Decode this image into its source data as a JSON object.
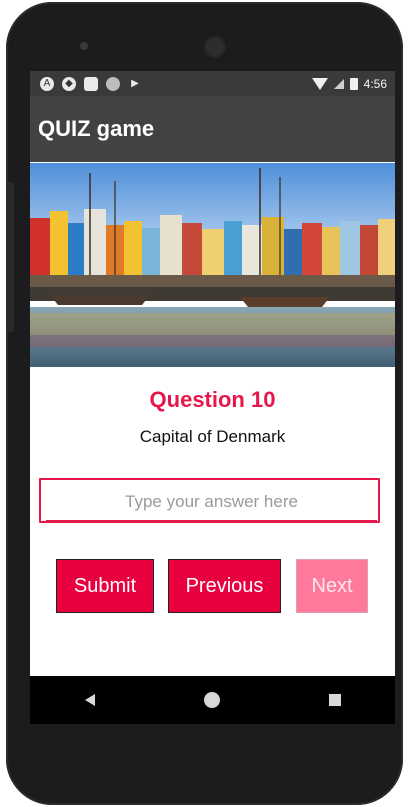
{
  "status_bar": {
    "icons_left": [
      "notification-icon",
      "shield-icon",
      "sd-card-icon",
      "circle-icon",
      "play-icon"
    ],
    "time": "4:56"
  },
  "toolbar": {
    "title": "QUIZ game"
  },
  "hero": {
    "description": ""
  },
  "question": {
    "title": "Question 10",
    "text": "Capital of Denmark"
  },
  "answer": {
    "value": "",
    "placeholder": "Type your answer here"
  },
  "buttons": {
    "submit": "Submit",
    "previous": "Previous",
    "next": "Next"
  },
  "colors": {
    "accent": "#e6174a",
    "button": "#e8003f",
    "button_disabled": "#ff7a9a",
    "toolbar": "#424242",
    "statusbar": "#3a3a3a"
  },
  "nav": {
    "icons": [
      "back-icon",
      "home-icon",
      "recent-apps-icon"
    ]
  }
}
